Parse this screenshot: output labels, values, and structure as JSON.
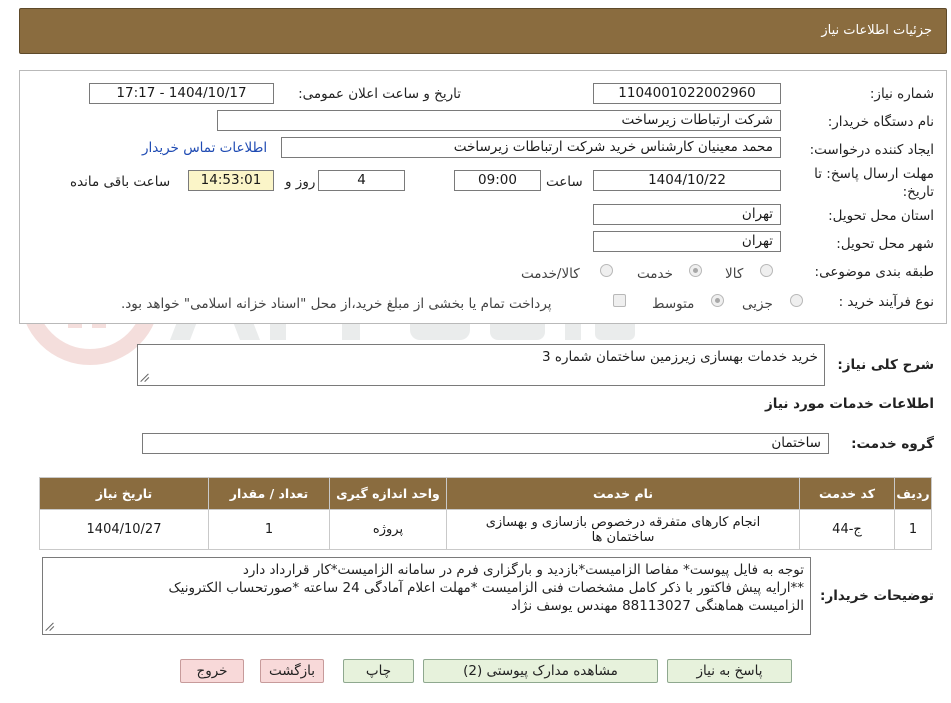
{
  "header": {
    "title": "جزئیات اطلاعات نیاز"
  },
  "form": {
    "need_number_label": "شماره نیاز:",
    "need_number": "1104001022002960",
    "announce_label": "تاریخ و ساعت اعلان عمومی:",
    "announce_value": "1404/10/17 - 17:17",
    "buyer_org_label": "نام دستگاه خریدار:",
    "buyer_org": "شرکت ارتباطات زیرساخت",
    "creator_label": "ایجاد کننده درخواست:",
    "creator": "محمد معینیان کارشناس خرید شرکت ارتباطات زیرساخت",
    "contact_link": "اطلاعات تماس خریدار",
    "deadline_label_line1": "مهلت ارسال پاسخ: تا",
    "deadline_label_line2": "تاریخ:",
    "deadline_date": "1404/10/22",
    "time_label": "ساعت",
    "deadline_time": "09:00",
    "days": "4",
    "days_label": "روز و",
    "remaining_time": "14:53:01",
    "remaining_label": "ساعت باقی مانده",
    "province_label": "استان محل تحویل:",
    "province": "تهران",
    "city_label": "شهر محل تحویل:",
    "city": "تهران",
    "category_label": "طبقه بندی موضوعی:",
    "category_options": [
      "کالا",
      "خدمت",
      "کالا/خدمت"
    ],
    "category_selected": "خدمت",
    "process_label": "نوع فرآیند خرید :",
    "process_options": [
      "جزیی",
      "متوسط"
    ],
    "process_selected": "متوسط",
    "payment_note": "پرداخت تمام یا بخشی از مبلغ خرید،از محل \"اسناد خزانه اسلامی\" خواهد بود."
  },
  "summary": {
    "label": "شرح کلی نیاز:",
    "value": "خرید خدمات بهسازی زیرزمین ساختمان شماره 3"
  },
  "services": {
    "section_title": "اطلاعات خدمات مورد نیاز",
    "group_label": "گروه خدمت:",
    "group_value": "ساختمان",
    "columns": [
      "ردیف",
      "کد خدمت",
      "نام خدمت",
      "واحد اندازه گیری",
      "تعداد / مقدار",
      "تاریخ نیاز"
    ],
    "rows": [
      [
        "1",
        "ج-44",
        "انجام کارهای متفرقه درخصوص بازسازی و بهسازی ساختمان ها",
        "پروژه",
        "1",
        "1404/10/27"
      ]
    ]
  },
  "buyer_notes": {
    "label": "توضیحات خریدار:",
    "lines": [
      "توجه به فایل پیوست* مفاصا الزامیست*بازدید و بارگزاری فرم در سامانه الزامیست*کار قرارداد دارد",
      "**ارایه پیش فاکتور با ذکر کامل مشخصات فنی الزامیست *مهلت اعلام آمادگی 24 ساعته *صورتحساب الکترونیک",
      "الزامیست هماهنگی 88113027 مهندس یوسف نژاد"
    ]
  },
  "buttons": {
    "reply": "پاسخ به نیاز",
    "attachments": "مشاهده مدارک پیوستی (2)",
    "print": "چاپ",
    "back": "بازگشت",
    "exit": "خروج"
  },
  "colors": {
    "header": "#8a6c3f",
    "button_green": "#e7f2dc",
    "button_red": "#f8d9d9",
    "link": "#1f4bb3"
  }
}
